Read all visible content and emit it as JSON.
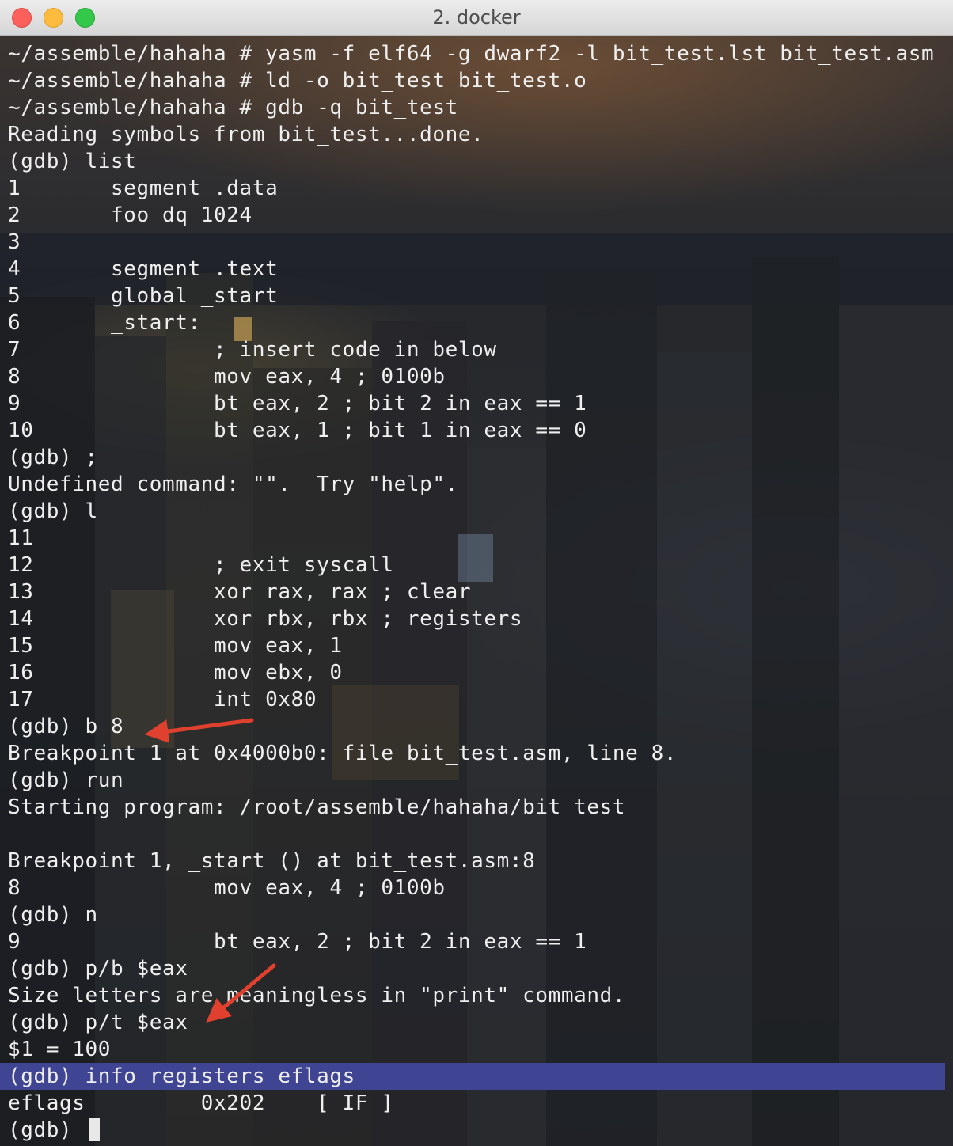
{
  "window": {
    "title": "2. docker"
  },
  "terminal": {
    "lines": [
      "~/assemble/hahaha # yasm -f elf64 -g dwarf2 -l bit_test.lst bit_test.asm",
      "~/assemble/hahaha # ld -o bit_test bit_test.o",
      "~/assemble/hahaha # gdb -q bit_test",
      "Reading symbols from bit_test...done.",
      "(gdb) list",
      "1       segment .data",
      "2       foo dq 1024",
      "3",
      "4       segment .text",
      "5       global _start",
      "6       _start:",
      "7               ; insert code in below",
      "8               mov eax, 4 ; 0100b",
      "9               bt eax, 2 ; bit 2 in eax == 1",
      "10              bt eax, 1 ; bit 1 in eax == 0",
      "(gdb) ;",
      "Undefined command: \"\".  Try \"help\".",
      "(gdb) l",
      "11",
      "12              ; exit syscall",
      "13              xor rax, rax ; clear",
      "14              xor rbx, rbx ; registers",
      "15              mov eax, 1",
      "16              mov ebx, 0",
      "17              int 0x80",
      "(gdb) b 8",
      "Breakpoint 1 at 0x4000b0: file bit_test.asm, line 8.",
      "(gdb) run",
      "Starting program: /root/assemble/hahaha/bit_test",
      "",
      "Breakpoint 1, _start () at bit_test.asm:8",
      "8               mov eax, 4 ; 0100b",
      "(gdb) n",
      "9               bt eax, 2 ; bit 2 in eax == 1",
      "(gdb) p/b $eax",
      "Size letters are meaningless in \"print\" command.",
      "(gdb) p/t $eax",
      "$1 = 100",
      "(gdb) info registers eflags",
      "eflags         0x202    [ IF ]",
      "(gdb) "
    ],
    "selected_line_index": 38,
    "cursor_line_index": 40
  },
  "colors": {
    "text": "#efefef",
    "selection": "#3f4593",
    "arrow": "#e0402e"
  }
}
